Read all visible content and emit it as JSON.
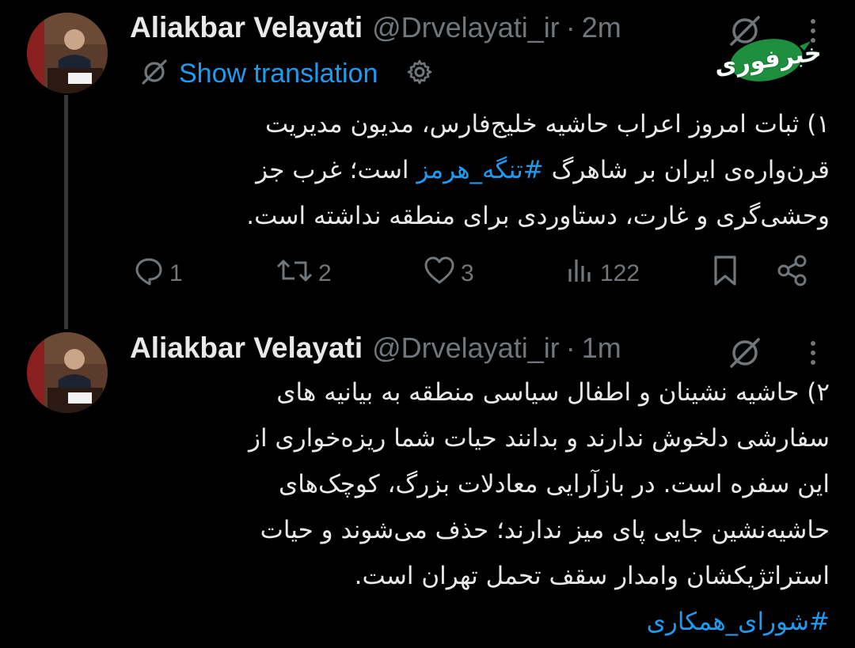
{
  "thread": [
    {
      "author": {
        "display_name": "Aliakbar Velayati",
        "handle": "@Drvelayati_ir",
        "time_sep": "·",
        "time": "2m"
      },
      "translation": {
        "label": "Show translation"
      },
      "text_lines": [
        "۱) ثبات امروز اعراب حاشیه خلیج‌فارس، مدیون مدیریت",
        "قرن‌واره‌ی ایران بر شاهرگ ",
        "#تنگه_هرمز",
        " است؛ غرب جز",
        "وحشی‌گری و غارت، دستاوردی برای منطقه نداشته است."
      ],
      "actions": {
        "reply_count": "1",
        "retweet_count": "2",
        "like_count": "3",
        "view_count": "122"
      }
    },
    {
      "author": {
        "display_name": "Aliakbar Velayati",
        "handle": "@Drvelayati_ir",
        "time_sep": "·",
        "time": "1m"
      },
      "text_lines": [
        "۲) حاشیه نشینان و اطفال سیاسی منطقه به بیانیه های",
        "سفارشی دلخوش ندارند و بدانند حیات شما ریزه‌خواری از",
        "این سفره است. در بازآرایی معادلات بزرگ، کوچک‌های",
        "حاشیه‌نشین جایی پای میز ندارند؛ حذف می‌شوند و حیات",
        "استراتژیکشان وامدار سقف تحمل تهران است."
      ],
      "hashtag": "#شورای_همکاری"
    }
  ],
  "watermark": {
    "text": "خبرفوری"
  },
  "colors": {
    "background": "#000000",
    "text_primary": "#e7e9ea",
    "text_secondary": "#71767b",
    "link": "#1d9bf0",
    "thread_line": "#333639",
    "watermark_green": "#1e8f3e"
  },
  "icons": [
    "grok-icon",
    "more-icon",
    "translate-icon",
    "gear-icon",
    "reply-icon",
    "retweet-icon",
    "like-icon",
    "views-icon",
    "bookmark-icon",
    "share-icon"
  ]
}
